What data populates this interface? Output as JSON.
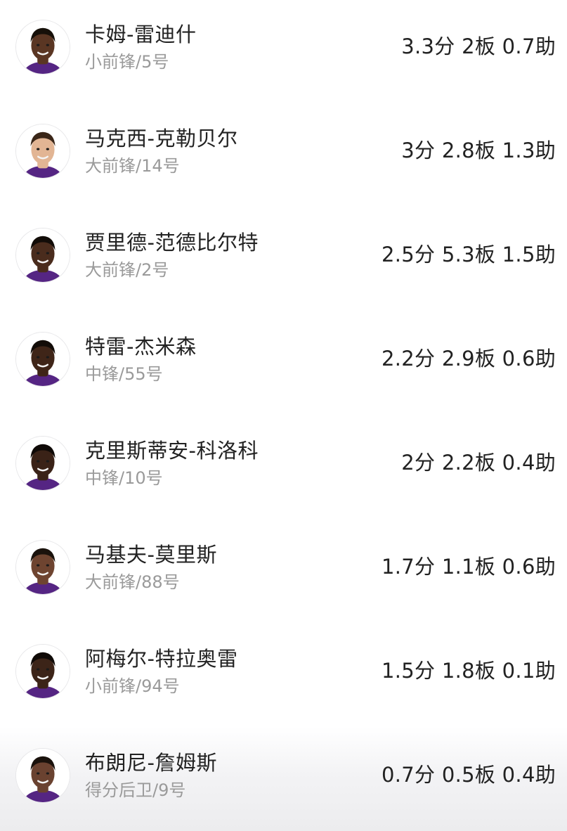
{
  "players": [
    {
      "name": "卡姆-雷迪什",
      "position": "小前锋/5号",
      "stats": "3.3分 2板 0.7助",
      "skin": "#5a3623",
      "hair": "#161009",
      "jersey": "#552583"
    },
    {
      "name": "马克西-克勒贝尔",
      "position": "大前锋/14号",
      "stats": "3分 2.8板 1.3助",
      "skin": "#e2b594",
      "hair": "#3a2618",
      "jersey": "#552583"
    },
    {
      "name": "贾里德-范德比尔特",
      "position": "大前锋/2号",
      "stats": "2.5分 5.3板 1.5助",
      "skin": "#4a2c1d",
      "hair": "#120c08",
      "jersey": "#552583"
    },
    {
      "name": "特雷-杰米森",
      "position": "中锋/55号",
      "stats": "2.2分 2.9板 0.6助",
      "skin": "#3f2518",
      "hair": "#120c08",
      "jersey": "#552583"
    },
    {
      "name": "克里斯蒂安-科洛科",
      "position": "中锋/10号",
      "stats": "2分 2.2板 0.4助",
      "skin": "#3a2217",
      "hair": "#0f0a07",
      "jersey": "#552583"
    },
    {
      "name": "马基夫-莫里斯",
      "position": "大前锋/88号",
      "stats": "1.7分 1.1板 0.6助",
      "skin": "#6e4430",
      "hair": "#1a120c",
      "jersey": "#552583"
    },
    {
      "name": "阿梅尔-特拉奥雷",
      "position": "小前锋/94号",
      "stats": "1.5分 1.8板 0.1助",
      "skin": "#3c2418",
      "hair": "#0f0a07",
      "jersey": "#552583"
    },
    {
      "name": "布朗尼-詹姆斯",
      "position": "得分后卫/9号",
      "stats": "0.7分 0.5板 0.4助",
      "skin": "#6a4230",
      "hair": "#1a120c",
      "jersey": "#552583"
    }
  ]
}
